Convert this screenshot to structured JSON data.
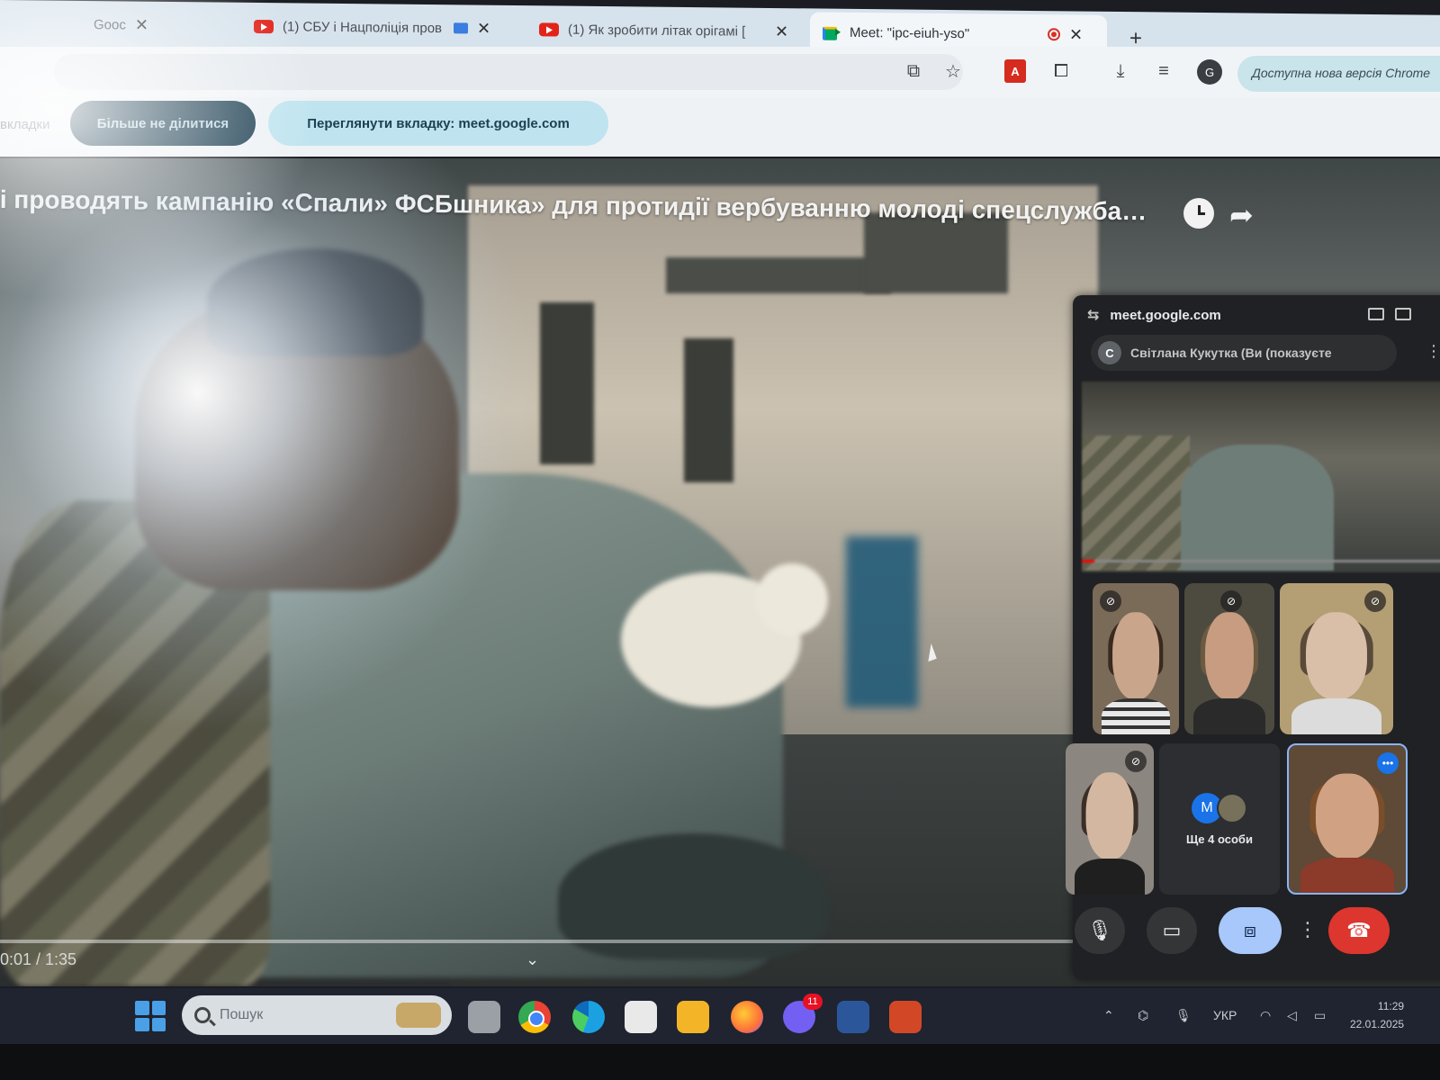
{
  "browser": {
    "tabs": [
      {
        "label": "Gooc",
        "icon": "page-icon"
      },
      {
        "label": "(1) СБУ і Нацполіція пров",
        "icon": "youtube-icon"
      },
      {
        "label": "(1) Як зробити літак орігамі [",
        "icon": "youtube-icon"
      },
      {
        "label": "Meet: \"ipc-eiuh-yso\"",
        "icon": "meet-icon"
      }
    ],
    "new_tab_label": "+",
    "update_notice": "Доступна нова версія Chrome"
  },
  "sharing_bar": {
    "left_fragment": "вкладки",
    "stop_sharing_label": "Більше не ділитися",
    "view_tab_label": "Переглянути вкладку: meet.google.com"
  },
  "video": {
    "title": "і проводять кампанію «Спали» ФСБшника» для протидії вербуванню молоді спецслужбами ...",
    "time": "0:01 / 1:35"
  },
  "meet_pip": {
    "domain": "meet.google.com",
    "presenter_initial": "C",
    "presenter_label": "Світлана Кукутка (Ви (показуєте",
    "more_people_initial": "M",
    "more_people_label": "Ще 4 особи"
  },
  "taskbar": {
    "search_placeholder": "Пошук",
    "viber_badge": "11",
    "language": "УКР",
    "time": "11:29",
    "date": "22.01.2025"
  }
}
